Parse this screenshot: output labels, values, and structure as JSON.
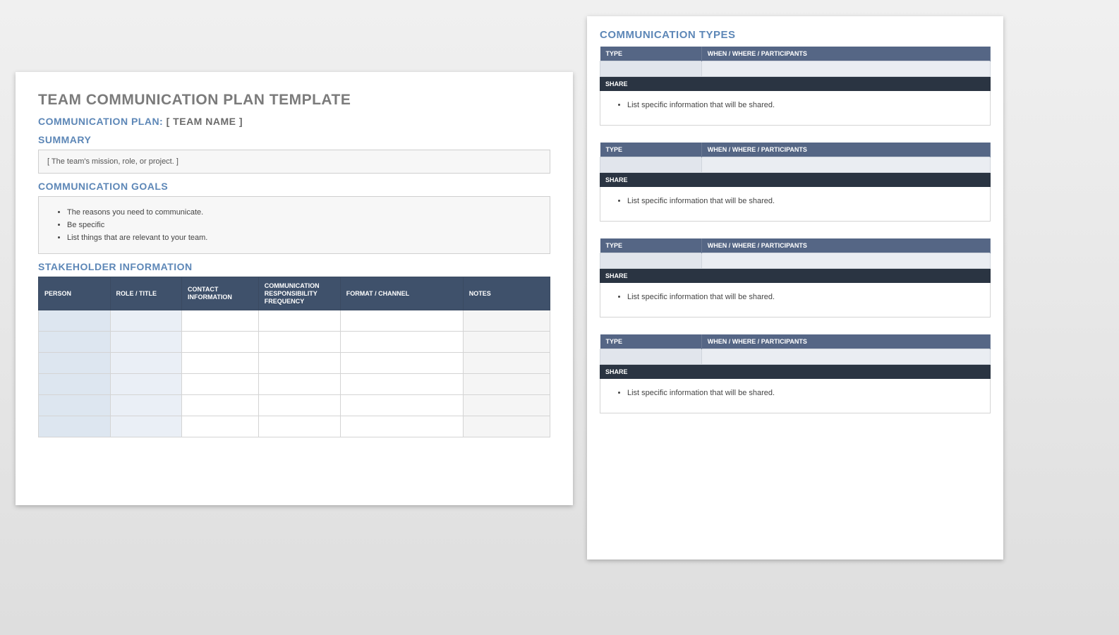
{
  "left": {
    "doc_title": "TEAM COMMUNICATION PLAN TEMPLATE",
    "plan_label": "COMMUNICATION PLAN:",
    "team_name": "[ TEAM NAME ]",
    "summary_heading": "SUMMARY",
    "summary_text": "[ The team's mission, role, or project. ]",
    "goals_heading": "COMMUNICATION GOALS",
    "goals": [
      "The reasons you need to communicate.",
      "Be specific",
      "List things that are relevant to your team."
    ],
    "stakeholder_heading": "STAKEHOLDER INFORMATION",
    "stakeholder_columns": [
      "PERSON",
      "ROLE / TITLE",
      "CONTACT INFORMATION",
      "COMMUNICATION RESPONSIBILITY FREQUENCY",
      "FORMAT / CHANNEL",
      "NOTES"
    ],
    "stakeholder_rows": 6
  },
  "right": {
    "heading": "COMMUNICATION TYPES",
    "col_type": "TYPE",
    "col_when": "WHEN / WHERE / PARTICIPANTS",
    "share_label": "SHARE",
    "share_item": "List specific information that will be shared.",
    "block_count": 4
  }
}
